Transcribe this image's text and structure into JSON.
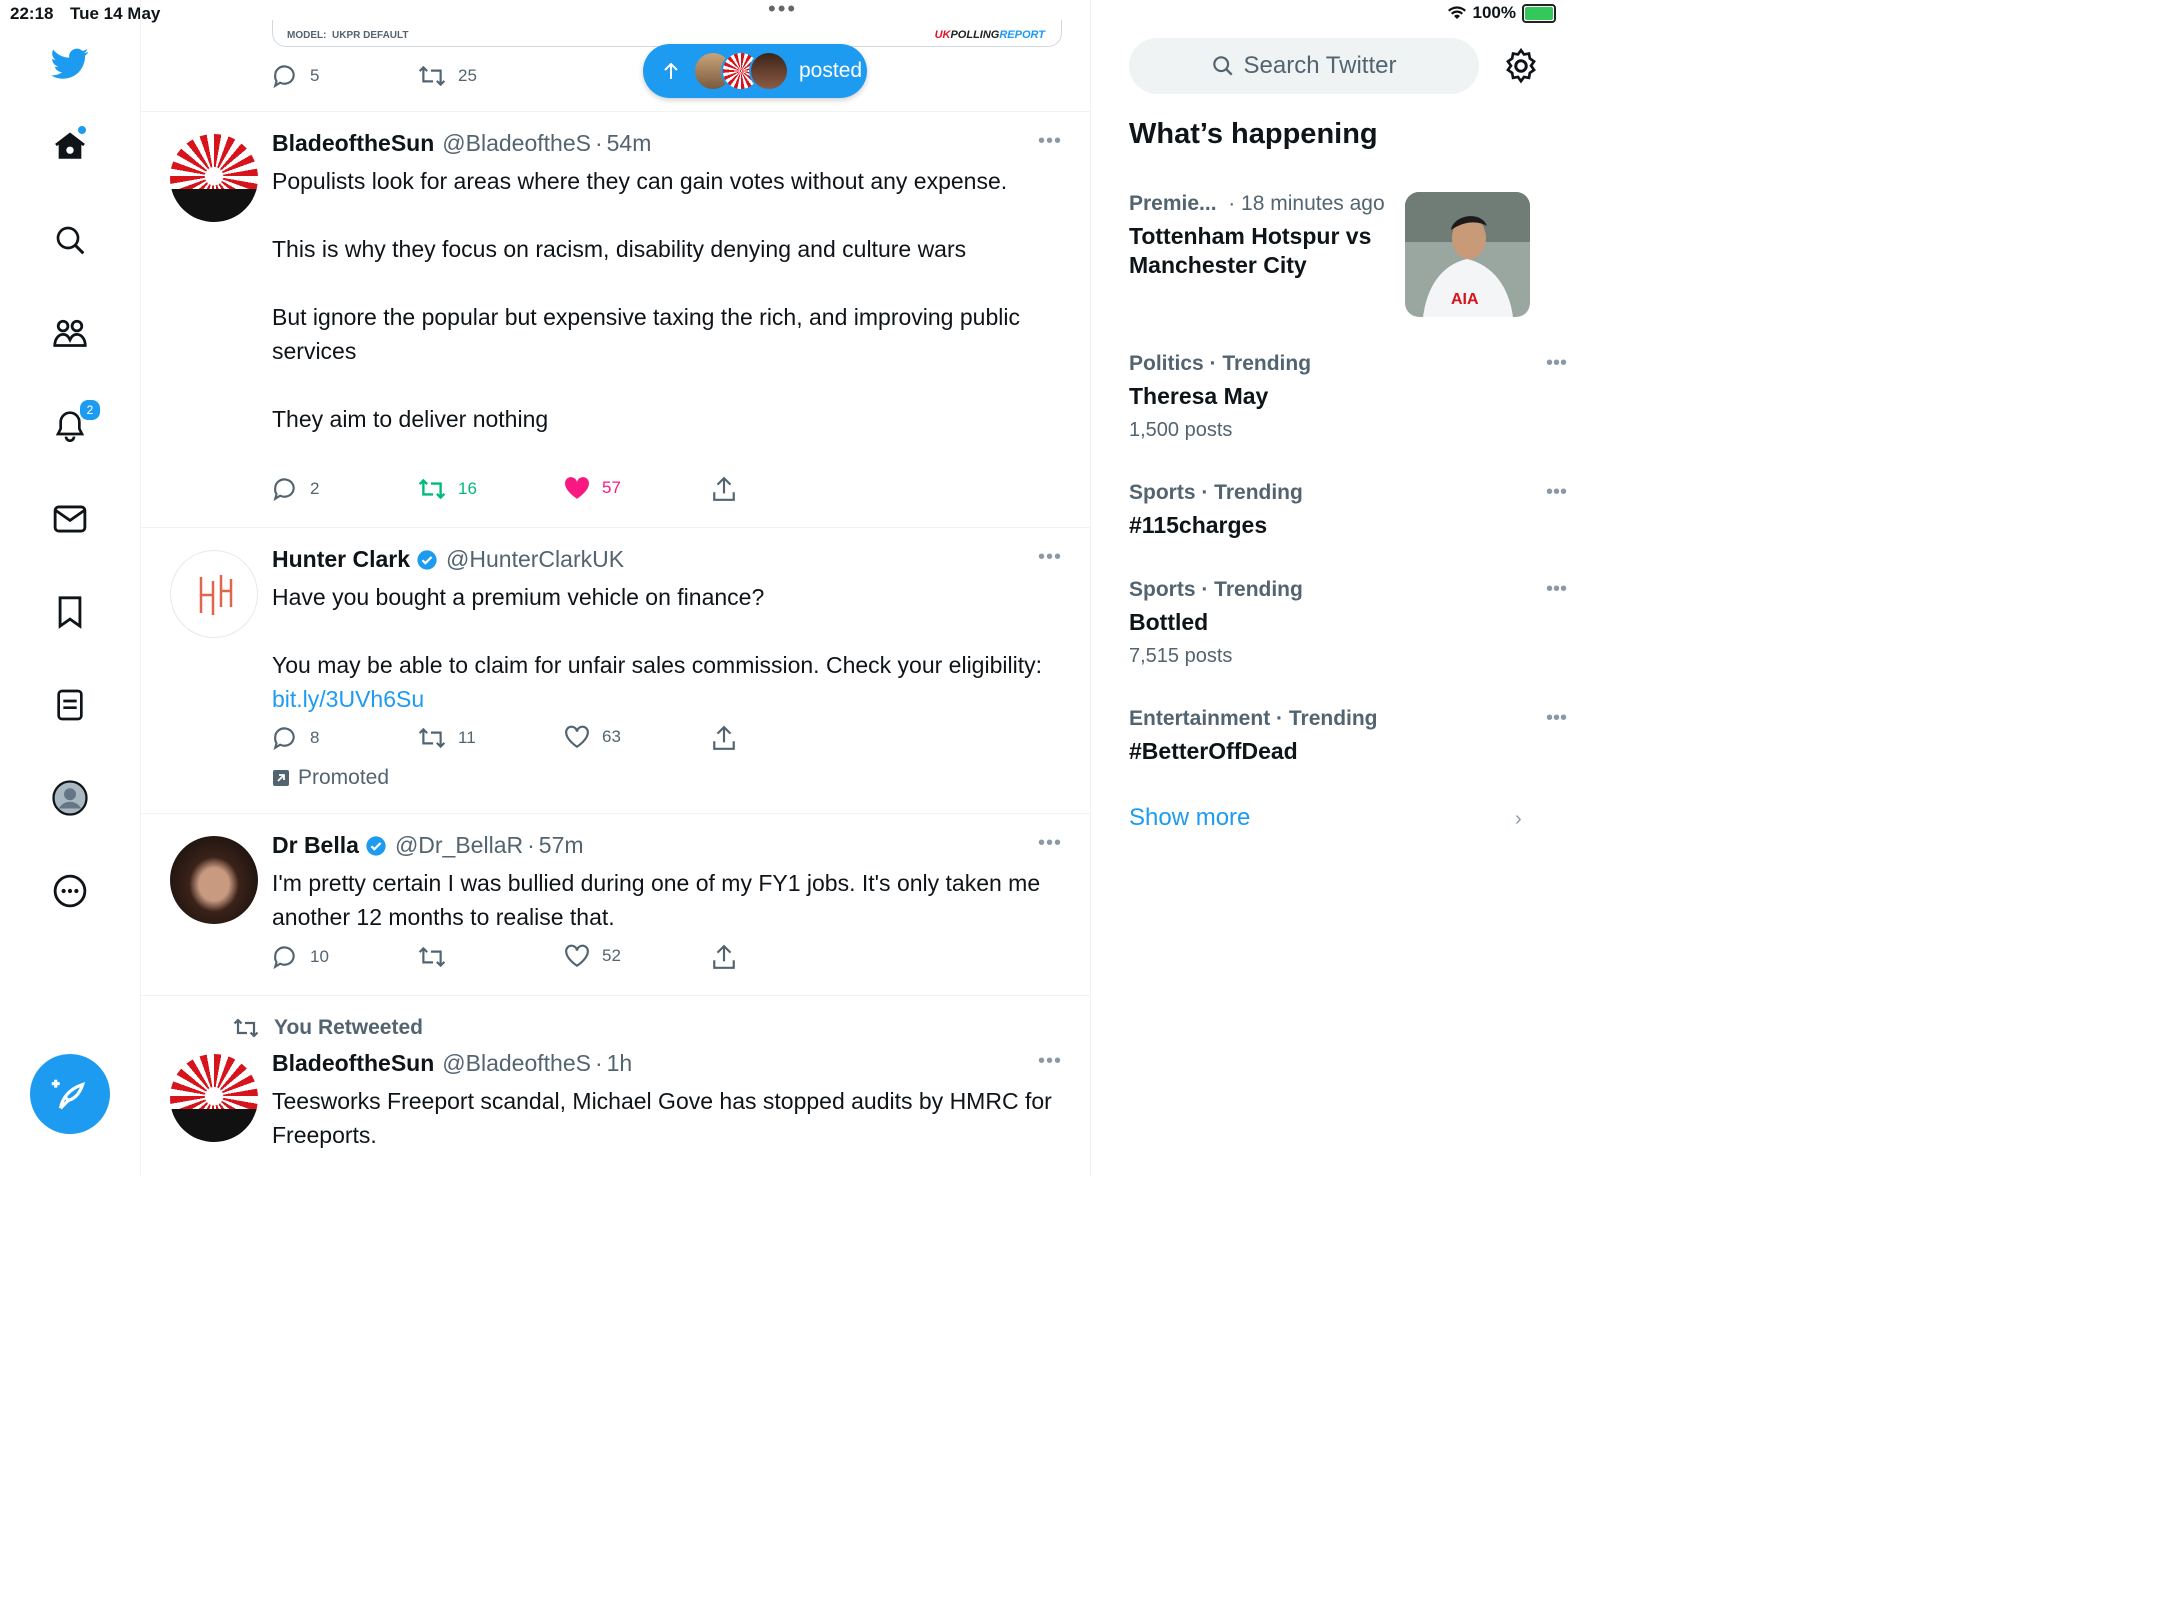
{
  "status_bar": {
    "time": "22:18",
    "date": "Tue 14 May",
    "battery": "100%",
    "battery_level": 1.0
  },
  "nav": {
    "notifications_badge": "2"
  },
  "top_card": {
    "model_label": "MODEL:",
    "model_value": "UKPR DEFAULT",
    "brand_uk": "UK",
    "brand_polling": "POLLING",
    "brand_report": "REPORT",
    "replies": "5",
    "retweets": "25"
  },
  "new_posts_pill": {
    "label": "posted"
  },
  "tweets": [
    {
      "name": "BladeoftheSun",
      "handle": "@BladeoftheS",
      "time": "54m",
      "text": "Populists look for areas where they can gain votes without any expense.\n\nThis is why they focus on racism, disability denying and culture wars\n\nBut ignore the popular but expensive taxing the rich, and improving public services\n\nThey aim to deliver nothing",
      "replies": "2",
      "retweets": "16",
      "likes": "57"
    },
    {
      "name": "Hunter Clark",
      "handle": "@HunterClarkUK",
      "text": "Have you bought a premium vehicle on finance?\n\nYou may be able to claim for unfair sales commission. Check your eligibility: ",
      "link": "bit.ly/3UVh6Su",
      "replies": "8",
      "retweets": "11",
      "likes": "63",
      "promoted": "Promoted"
    },
    {
      "name": "Dr Bella",
      "handle": "@Dr_BellaR",
      "time": "57m",
      "text": "I'm pretty certain I was bullied during one of my FY1 jobs. It's only taken me another 12 months to realise that.",
      "replies": "10",
      "likes": "52"
    },
    {
      "retweet_label": "You Retweeted",
      "name": "BladeoftheSun",
      "handle": "@BladeoftheS",
      "time": "1h",
      "text": "Teesworks Freeport scandal, Michael Gove has stopped audits by HMRC for Freeports."
    }
  ],
  "sidebar": {
    "search_placeholder": "Search Twitter",
    "heading": "What’s happening",
    "trends": [
      {
        "category": "Premie...",
        "age": "· 18 minutes ago",
        "title": "Tottenham Hotspur vs Manchester City"
      },
      {
        "category": "Politics · Trending",
        "title": "Theresa May",
        "count": "1,500 posts"
      },
      {
        "category": "Sports · Trending",
        "title": "#115charges"
      },
      {
        "category": "Sports · Trending",
        "title": "Bottled",
        "count": "7,515 posts"
      },
      {
        "category": "Entertainment · Trending",
        "title": "#BetterOffDead"
      }
    ],
    "show_more": "Show more"
  },
  "colors": {
    "accent": "#1d9bf0",
    "like": "#f91880",
    "retweet_active": "#00ba7c",
    "muted": "#536471"
  }
}
